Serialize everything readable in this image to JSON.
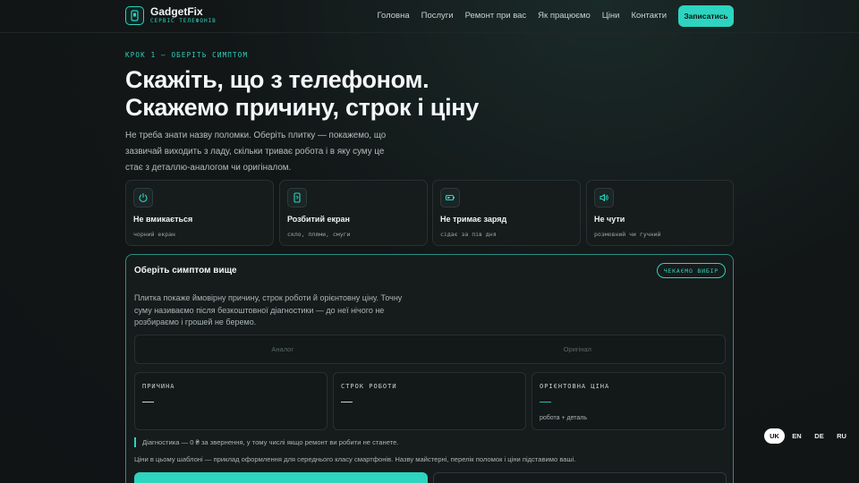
{
  "brand": {
    "name": "GadgetFix",
    "subtitle": "СЕРВІС ТЕЛЕФОНІВ"
  },
  "nav": [
    "Головна",
    "Послуги",
    "Ремонт при вас",
    "Як працюємо",
    "Ціни",
    "Контакти"
  ],
  "cta_label": "Записатись",
  "hero": {
    "step": "КРОК 1 — ОБЕРІТЬ СИМПТОМ",
    "title_line1": "Скажіть, що з телефоном.",
    "title_line2": "Скажемо причину, строк і ціну",
    "lead": "Не треба знати назву поломки. Оберіть плитку — покажемо, що зазвичай виходить з ладу, скільки триває робота і в яку суму це стає з деталлю-аналогом чи оригіналом."
  },
  "tiles": [
    {
      "icon": "power-icon",
      "title": "Не вмикається",
      "sub": "чорний екран"
    },
    {
      "icon": "phone-screen-icon",
      "title": "Розбитий екран",
      "sub": "скло, плями, смуги"
    },
    {
      "icon": "battery-icon",
      "title": "Не тримає заряд",
      "sub": "сідає за пів дня"
    },
    {
      "icon": "speaker-icon",
      "title": "Не чути",
      "sub": "розмовний чи гучний"
    }
  ],
  "panel": {
    "title": "Оберіть симптом вище",
    "badge": "ЧЕКАЄМО ВИБІР",
    "desc": "Плитка покаже ймовірну причину, строк роботи й орієнтовну ціну. Точну суму називаємо після безкоштовної діагностики — до неї нічого не розбираємо і грошей не беремо.",
    "toggle": [
      "Аналог",
      "Оригінал"
    ],
    "cards": [
      {
        "label": "ПРИЧИНА",
        "value": "—",
        "note": ""
      },
      {
        "label": "СТРОК РОБОТИ",
        "value": "—",
        "note": ""
      },
      {
        "label": "ОРІЄНТОВНА ЦІНА",
        "value": "—",
        "note": "робота + деталь"
      }
    ],
    "note1": "Діагностика — 0 ₴ за звернення, у тому числі якщо ремонт ви робити не станете.",
    "note2": "Ціни в цьому шаблоні — приклад оформлення для середнього класу смартфонів. Назву майстерні, перелік поломок і ціни підставимо ваші."
  },
  "languages": [
    "UK",
    "EN",
    "DE",
    "RU"
  ],
  "active_language": "UK",
  "colors": {
    "accent": "#2dd4bf",
    "background": "#121617"
  }
}
